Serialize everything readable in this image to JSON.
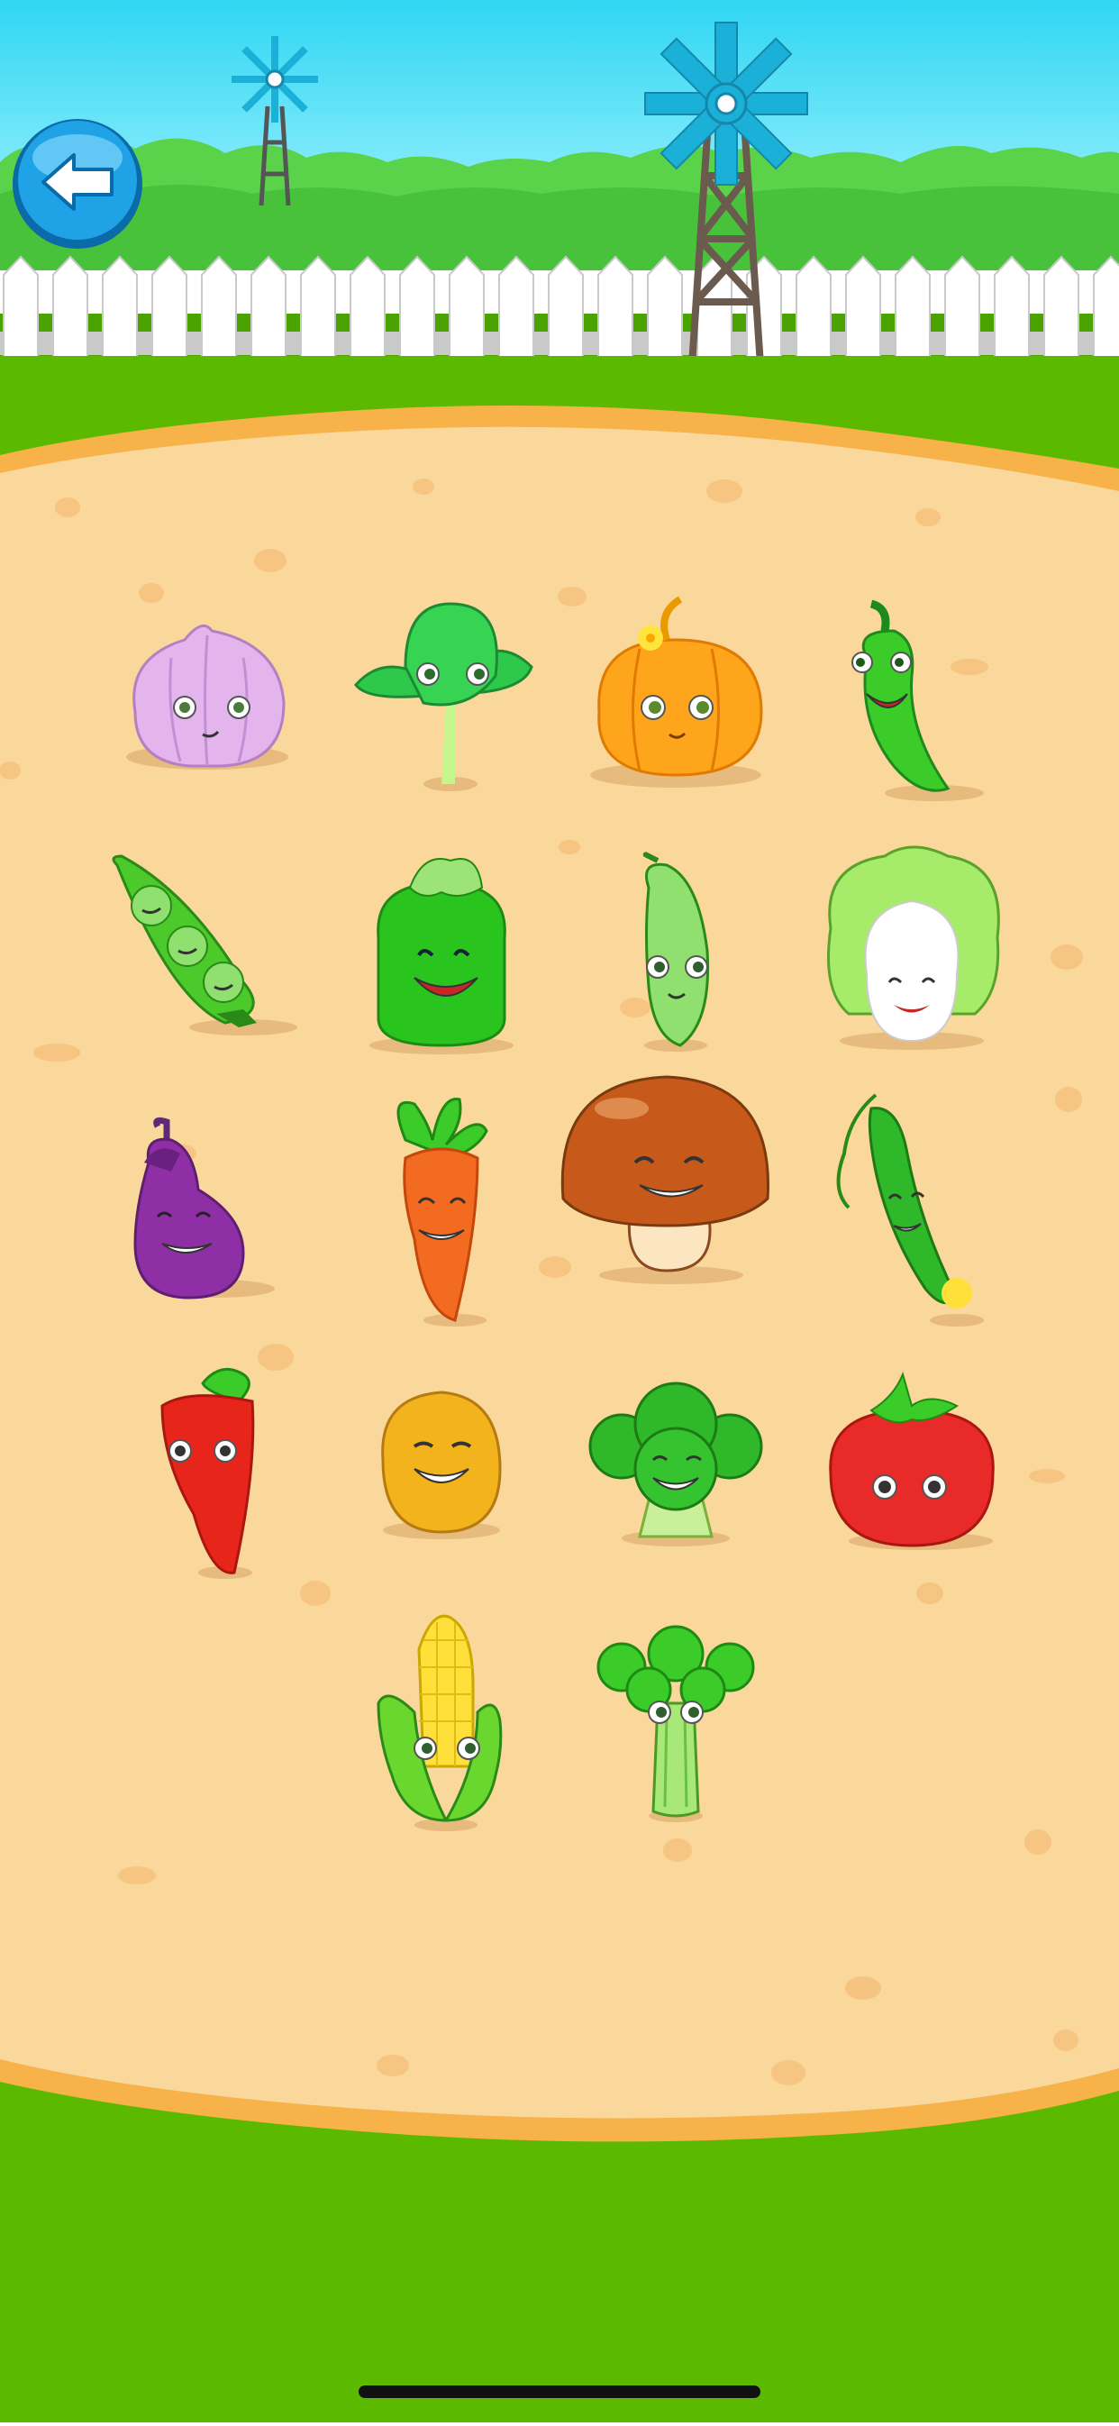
{
  "screen": {
    "name": "vegetables-selection",
    "colors": {
      "sky_top": "#2fd6f2",
      "sky_bottom": "#8ff0ff",
      "grass": "#5bba00",
      "grass_dark": "#4aa300",
      "dirt": "#fad79a",
      "dirt_edge": "#f7b24a",
      "fence": "#ffffff",
      "fence_shadow": "#c9c9c9",
      "button_blue": "#1fa3e6"
    }
  },
  "back_button": {
    "icon": "arrow-left-icon"
  },
  "vegetables": [
    {
      "name": "garlic",
      "icon": "garlic-icon"
    },
    {
      "name": "bok-choy",
      "icon": "bok-choy-icon"
    },
    {
      "name": "pumpkin",
      "icon": "pumpkin-icon"
    },
    {
      "name": "green-pepper",
      "icon": "green-pepper-icon"
    },
    {
      "name": "peas",
      "icon": "peas-icon"
    },
    {
      "name": "green-squash",
      "icon": "green-squash-icon"
    },
    {
      "name": "bitter-melon",
      "icon": "bitter-melon-icon"
    },
    {
      "name": "cabbage",
      "icon": "cabbage-icon"
    },
    {
      "name": "eggplant",
      "icon": "eggplant-icon"
    },
    {
      "name": "carrot",
      "icon": "carrot-icon"
    },
    {
      "name": "mushroom",
      "icon": "mushroom-icon"
    },
    {
      "name": "cucumber",
      "icon": "cucumber-icon"
    },
    {
      "name": "chili",
      "icon": "chili-icon"
    },
    {
      "name": "potato",
      "icon": "potato-icon"
    },
    {
      "name": "broccoli",
      "icon": "broccoli-icon"
    },
    {
      "name": "tomato",
      "icon": "tomato-icon"
    },
    {
      "name": "corn",
      "icon": "corn-icon"
    },
    {
      "name": "celery",
      "icon": "celery-icon"
    }
  ]
}
